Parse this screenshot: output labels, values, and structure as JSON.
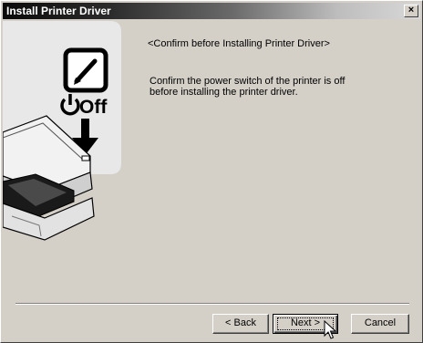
{
  "window": {
    "title": "Install Printer Driver",
    "close_glyph": "×"
  },
  "content": {
    "heading": "<Confirm before Installing Printer Driver>",
    "body_line1": "Confirm the power switch of the printer is off",
    "body_line2": "before installing the printer driver."
  },
  "illustration": {
    "off_label": "Off",
    "icons": [
      "note-icon",
      "power-icon",
      "down-arrow-icon",
      "printer-illustration"
    ]
  },
  "buttons": {
    "back_label": "< Back",
    "next_label": "Next >",
    "cancel_label": "Cancel"
  },
  "colors": {
    "dialog_face": "#d4d0c8",
    "title_start": "#0a0a0a",
    "title_end": "#d8d8d8"
  }
}
